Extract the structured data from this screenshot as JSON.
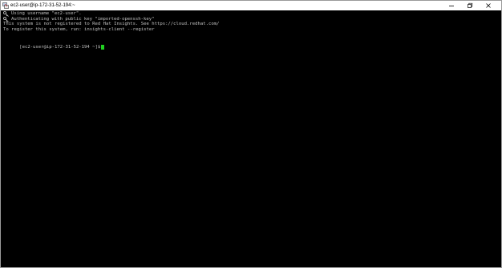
{
  "window": {
    "title": "ec2-user@ip-172-31-52-194:~",
    "app_icon": "putty-icon",
    "controls": [
      "minimize-icon",
      "maximize-icon",
      "close-icon"
    ]
  },
  "terminal": {
    "lines": [
      "Using username \"ec2-user\".",
      "Authenticating with public key \"imported-openssh-key\"",
      "This system is not registered to Red Hat Insights. See https://cloud.redhat.com/",
      "To register this system, run: insights-client --register",
      ""
    ],
    "key_icon": "key-icon",
    "prompt": "[ec2-user@ip-172-31-52-194 ~]$",
    "colors": {
      "background": "#000000",
      "text": "#c0c0c0",
      "cursor": "#20d020"
    }
  }
}
